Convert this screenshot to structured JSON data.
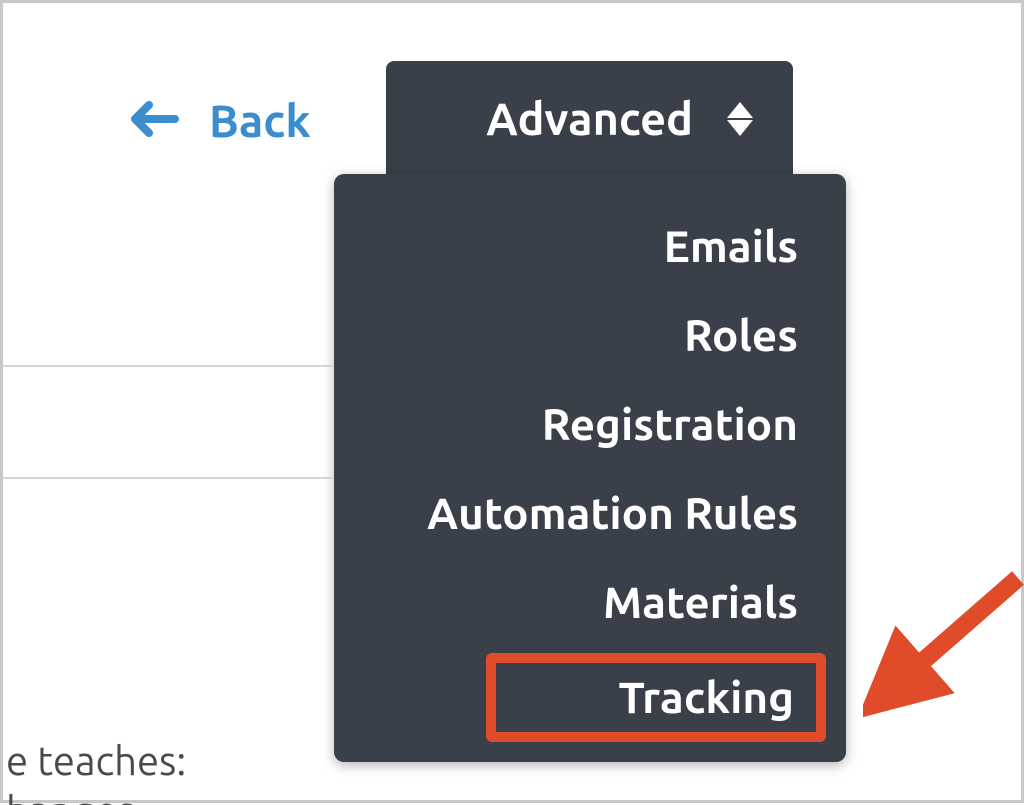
{
  "navigation": {
    "back_label": "Back"
  },
  "dropdown": {
    "toggle_label": "Advanced",
    "items": [
      {
        "label": "Emails"
      },
      {
        "label": "Roles"
      },
      {
        "label": "Registration"
      },
      {
        "label": "Automation Rules"
      },
      {
        "label": "Materials"
      },
      {
        "label": "Tracking"
      }
    ]
  },
  "partial_text": {
    "line1": "e teaches:",
    "line2": "hanges"
  },
  "colors": {
    "accent_blue": "#3b8dce",
    "dropdown_bg": "#3a4049",
    "highlight_border": "#e04b2a"
  }
}
